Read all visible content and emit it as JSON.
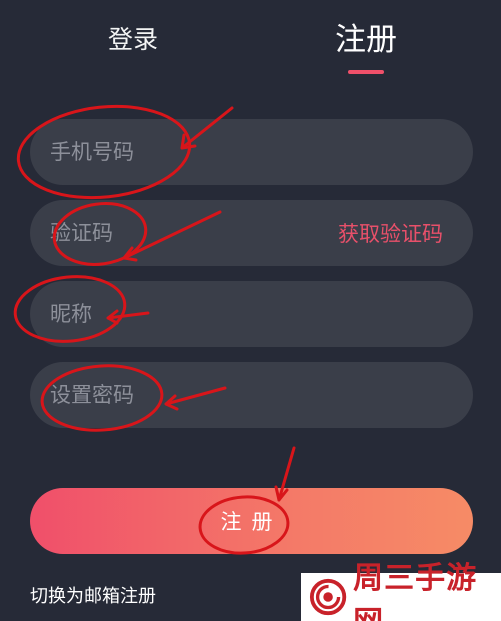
{
  "tabs": {
    "login": "登录",
    "register": "注册",
    "active": "register"
  },
  "form": {
    "phone_placeholder": "手机号码",
    "code_placeholder": "验证码",
    "get_code_label": "获取验证码",
    "nickname_placeholder": "昵称",
    "password_placeholder": "设置密码",
    "submit_label": "注册"
  },
  "footer": {
    "switch_label": "切换为邮箱注册"
  },
  "watermark": {
    "text": "周三手游网"
  },
  "colors": {
    "background": "#262a37",
    "field": "#3a3e49",
    "accent": "#f0506a",
    "annotation": "#d8151a"
  }
}
